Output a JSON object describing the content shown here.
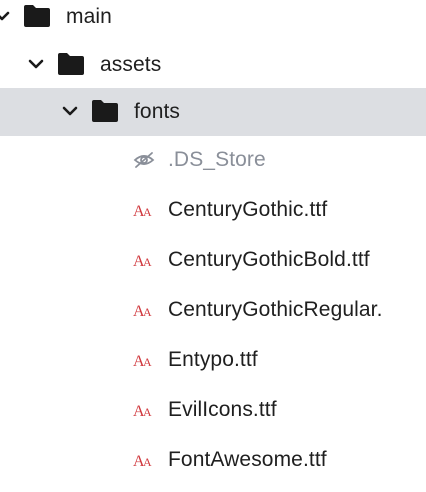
{
  "tree": {
    "main": {
      "label": "main",
      "icon": "folder-icon",
      "expanded": true
    },
    "assets": {
      "label": "assets",
      "icon": "folder-icon",
      "expanded": true
    },
    "fonts": {
      "label": "fonts",
      "icon": "folder-icon",
      "expanded": true,
      "selected": true
    },
    "files": [
      {
        "label": ".DS_Store",
        "icon": "hidden-file-icon"
      },
      {
        "label": "CenturyGothic.ttf",
        "icon": "font-file-icon"
      },
      {
        "label": "CenturyGothicBold.ttf",
        "icon": "font-file-icon"
      },
      {
        "label": "CenturyGothicRegular.",
        "icon": "font-file-icon"
      },
      {
        "label": "Entypo.ttf",
        "icon": "font-file-icon"
      },
      {
        "label": "EvilIcons.ttf",
        "icon": "font-file-icon"
      },
      {
        "label": "FontAwesome.ttf",
        "icon": "font-file-icon"
      }
    ]
  },
  "colors": {
    "selected_row": "#dcdee2",
    "text": "#1f1f1f",
    "muted_text": "#8a8f99",
    "font_icon": "#d0383d",
    "folder": "#1a1a1a"
  }
}
